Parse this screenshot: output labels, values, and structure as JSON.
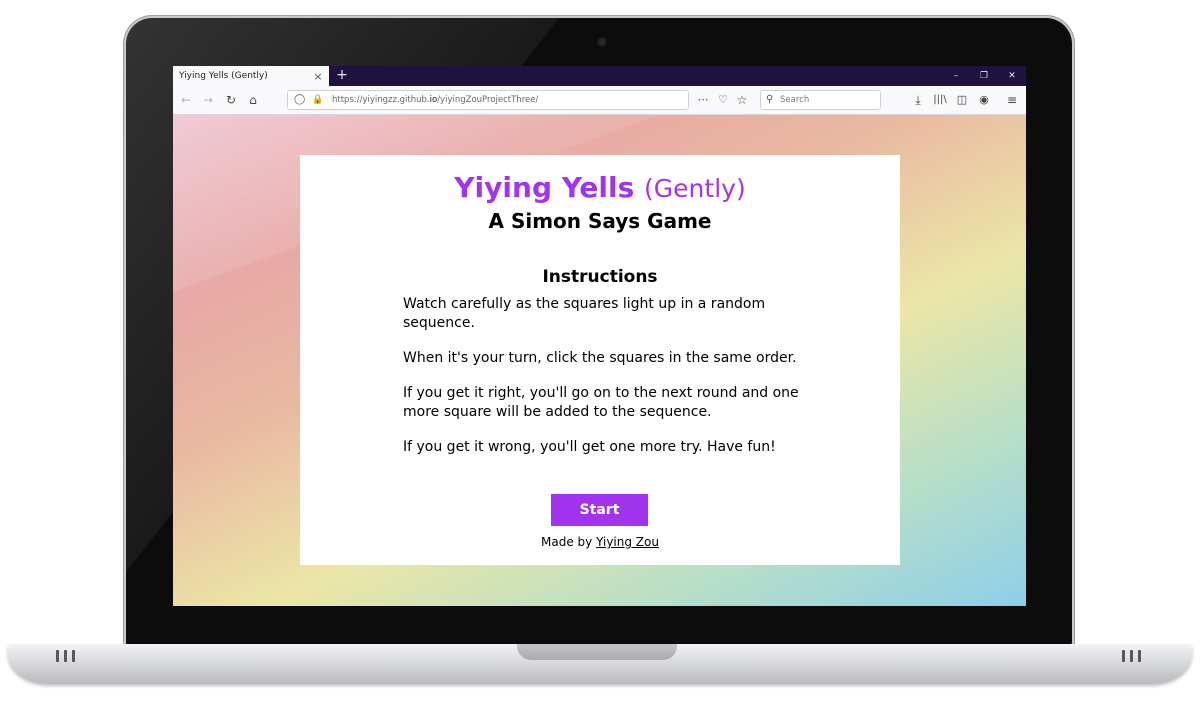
{
  "browser": {
    "tab_title": "Yiying Yells (Gently)",
    "tab_close": "×",
    "new_tab": "+",
    "url_prefix": "https://yiyingzz.github.",
    "url_host": "io",
    "url_path": "/yiyingZouProjectThree/",
    "search_placeholder": "Search",
    "icons": [
      "back-icon",
      "forward-icon",
      "reload-icon",
      "home-icon",
      "shield-icon",
      "lock-icon",
      "more-icon",
      "pocket-icon",
      "star-icon",
      "search-icon",
      "download-icon",
      "library-icon",
      "sidebar-icon",
      "account-icon",
      "menu-icon"
    ]
  },
  "page": {
    "title_main": "Yiying Yells",
    "title_paren": "(Gently)",
    "subtitle": "A Simon Says Game",
    "instructions_heading": "Instructions",
    "instructions": [
      "Watch carefully as the squares light up in a random sequence.",
      "When it's your turn, click the squares in the same order.",
      "If you get it right, you'll go on to the next round and one more square will be added to the sequence.",
      "If you get it wrong, you'll get one more try. Have fun!"
    ],
    "start_label": "Start",
    "credit_prefix": "Made by",
    "credit_name": "Yiying Zou"
  },
  "colors": {
    "accent": "#a233ee",
    "tab_bar": "#20123e"
  }
}
